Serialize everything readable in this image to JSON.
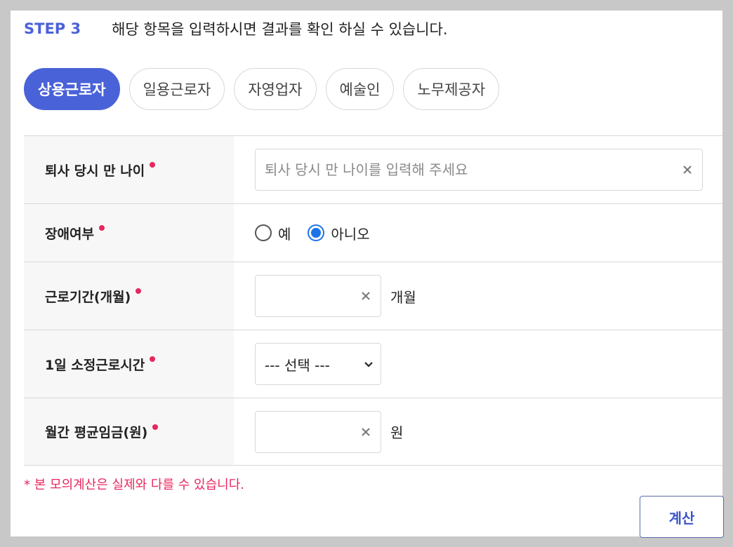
{
  "step": {
    "label": "STEP 3",
    "description": "해당 항목을 입력하시면 결과를 확인 하실 수 있습니다."
  },
  "tabs": [
    {
      "label": "상용근로자",
      "active": true
    },
    {
      "label": "일용근로자",
      "active": false
    },
    {
      "label": "자영업자",
      "active": false
    },
    {
      "label": "예술인",
      "active": false
    },
    {
      "label": "노무제공자",
      "active": false
    }
  ],
  "form": {
    "age": {
      "label": "퇴사 당시 만 나이",
      "placeholder": "퇴사 당시 만 나이를 입력해 주세요",
      "value": ""
    },
    "disability": {
      "label": "장애여부",
      "options": [
        "예",
        "아니오"
      ],
      "selected": "아니오"
    },
    "period": {
      "label": "근로기간(개월)",
      "value": "",
      "unit": "개월"
    },
    "hours": {
      "label": "1일 소정근로시간",
      "selected": "--- 선택 ---"
    },
    "wage": {
      "label": "월간 평균임금(원)",
      "value": "",
      "unit": "원"
    }
  },
  "notice": "* 본 모의계산은 실제와 다를 수 있습니다.",
  "calc_button": "계산",
  "colors": {
    "accent": "#4a62d8",
    "required": "#e8275e",
    "radio_checked": "#1a73e8"
  },
  "icons": {
    "clear": "close-icon",
    "select_arrow": "chevron-down-icon"
  }
}
